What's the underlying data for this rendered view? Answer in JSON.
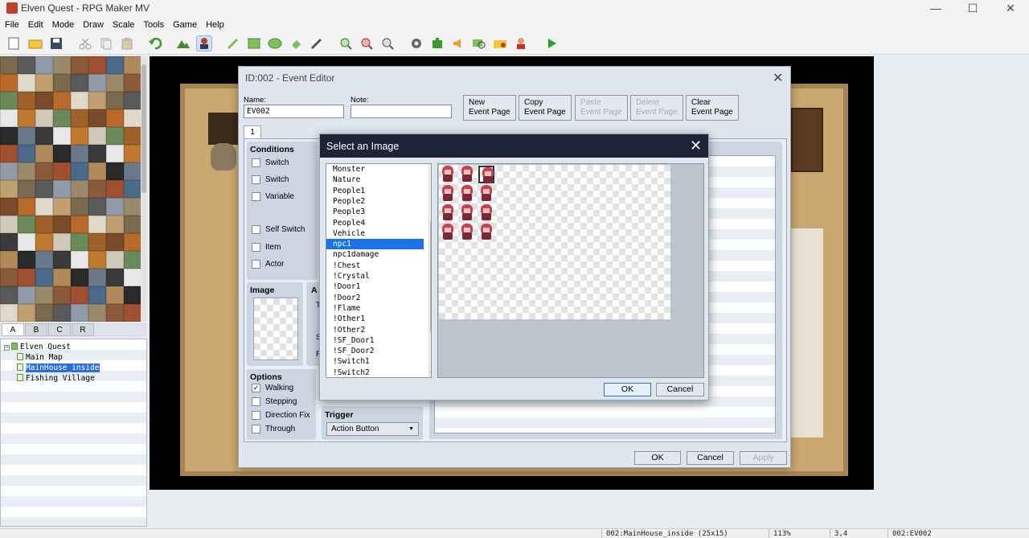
{
  "window": {
    "title": "Elven Quest - RPG Maker MV",
    "minimize": "—",
    "maximize": "☐",
    "close": "✕"
  },
  "menu": [
    "File",
    "Edit",
    "Mode",
    "Draw",
    "Scale",
    "Tools",
    "Game",
    "Help"
  ],
  "toolbar_icons": [
    "new-icon",
    "open-icon",
    "save-icon",
    "cut-icon",
    "copy-icon",
    "paste-icon",
    "undo-icon",
    "map-mode-icon",
    "event-mode-icon",
    "pencil-icon",
    "rectangle-icon",
    "ellipse-icon",
    "fill-icon",
    "shadow-pen-icon",
    "zoom-in-icon",
    "zoom-out-icon",
    "zoom-actual-icon",
    "database-icon",
    "plugin-icon",
    "sound-test-icon",
    "event-search-icon",
    "resource-icon",
    "character-generator-icon",
    "playtest-icon"
  ],
  "palette_tabs": [
    "A",
    "B",
    "C",
    "R"
  ],
  "map_tree": {
    "project": "Elven Quest",
    "maps": [
      "Main Map",
      "MainHouse_inside",
      "Fishing Village"
    ],
    "selected": "MainHouse_inside"
  },
  "status": {
    "map": "002:MainHouse_inside (25x15)",
    "zoom": "113%",
    "coords": "3,4",
    "event": "002:EV002"
  },
  "event_editor": {
    "title": "ID:002 - Event Editor",
    "name_label": "Name:",
    "name_value": "EV002",
    "note_label": "Note:",
    "note_value": "",
    "buttons": {
      "new_page": [
        "New",
        "Event Page"
      ],
      "copy_page": [
        "Copy",
        "Event Page"
      ],
      "paste_page": [
        "Paste",
        "Event Page"
      ],
      "delete_page": [
        "Delete",
        "Event Page"
      ],
      "clear_page": [
        "Clear",
        "Event Page"
      ]
    },
    "page_tab": "1",
    "conditions": {
      "header": "Conditions",
      "items": [
        "Switch",
        "Switch",
        "Variable",
        "Self Switch",
        "Item",
        "Actor"
      ]
    },
    "image_header": "Image",
    "partial_labels": [
      "A",
      "T",
      "S",
      "F"
    ],
    "options": {
      "header": "Options",
      "items": [
        {
          "label": "Walking",
          "checked": true
        },
        {
          "label": "Stepping",
          "checked": false
        },
        {
          "label": "Direction Fix",
          "checked": false
        },
        {
          "label": "Through",
          "checked": false
        }
      ]
    },
    "trigger": {
      "header": "Trigger",
      "value": "Action Button"
    },
    "ok": "OK",
    "cancel": "Cancel",
    "apply": "Apply"
  },
  "select_image": {
    "title": "Select an Image",
    "files": [
      "Monster",
      "Nature",
      "People1",
      "People2",
      "People3",
      "People4",
      "Vehicle",
      "npc1",
      "npc1damage",
      "!Chest",
      "!Crystal",
      "!Door1",
      "!Door2",
      "!Flame",
      "!Other1",
      "!Other2",
      "!SF_Door1",
      "!SF_Door2",
      "!Switch1",
      "!Switch2"
    ],
    "selected": "npc1",
    "ok": "OK",
    "cancel": "Cancel"
  }
}
